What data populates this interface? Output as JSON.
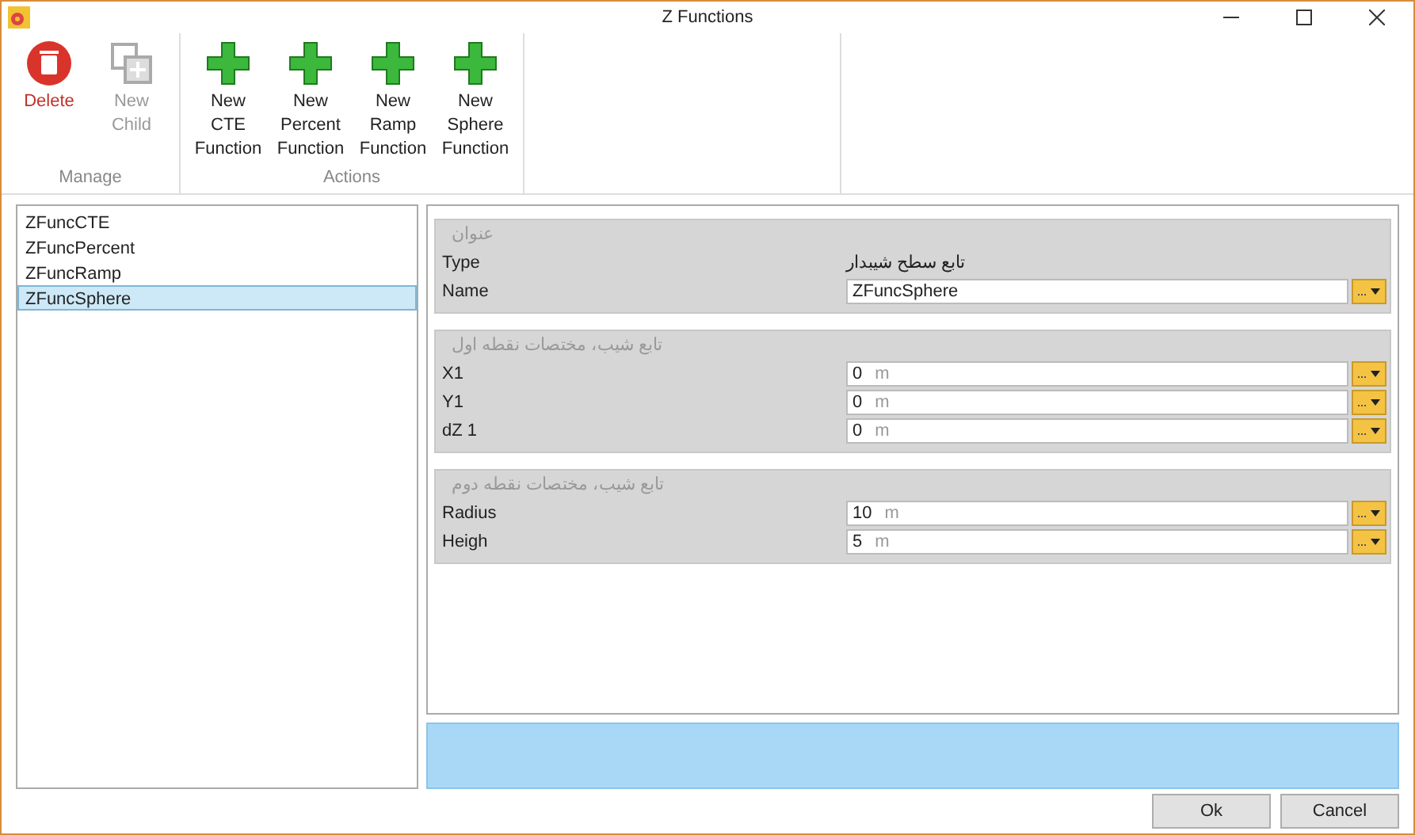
{
  "window": {
    "title": "Z Functions"
  },
  "ribbon": {
    "groups": [
      {
        "label": "Manage",
        "buttons": [
          {
            "kind": "delete",
            "label": "Delete",
            "disabled": false
          },
          {
            "kind": "child",
            "label": "New Child",
            "disabled": true
          }
        ]
      },
      {
        "label": "Actions",
        "buttons": [
          {
            "kind": "add",
            "label": "New CTE Function",
            "disabled": false
          },
          {
            "kind": "add",
            "label": "New Percent Function",
            "disabled": false
          },
          {
            "kind": "add",
            "label": "New Ramp Function",
            "disabled": false
          },
          {
            "kind": "add",
            "label": "New Sphere Function",
            "disabled": false
          }
        ]
      }
    ]
  },
  "list": [
    {
      "label": "ZFuncCTE",
      "selected": false
    },
    {
      "label": "ZFuncPercent",
      "selected": false
    },
    {
      "label": "ZFuncRamp",
      "selected": false
    },
    {
      "label": "ZFuncSphere",
      "selected": true
    }
  ],
  "sections": [
    {
      "title": "عنوان",
      "rows": [
        {
          "kind": "text",
          "label": "Type",
          "value": "تابع سطح شیبدار"
        },
        {
          "kind": "field",
          "label": "Name",
          "value": "ZFuncSphere"
        }
      ]
    },
    {
      "title": "تابع شیب، مختصات نقطه اول",
      "rows": [
        {
          "kind": "field",
          "label": "X1",
          "value": "0",
          "unit": "m"
        },
        {
          "kind": "field",
          "label": "Y1",
          "value": "0",
          "unit": "m"
        },
        {
          "kind": "field",
          "label": "dZ 1",
          "value": "0",
          "unit": "m"
        }
      ]
    },
    {
      "title": "تابع شیب، مختصات نقطه دوم",
      "rows": [
        {
          "kind": "field",
          "label": "Radius",
          "value": "10",
          "unit": "m"
        },
        {
          "kind": "field",
          "label": "Heigh",
          "value": "5",
          "unit": "m"
        }
      ]
    }
  ],
  "buttons": [
    "Ok",
    "Cancel"
  ]
}
